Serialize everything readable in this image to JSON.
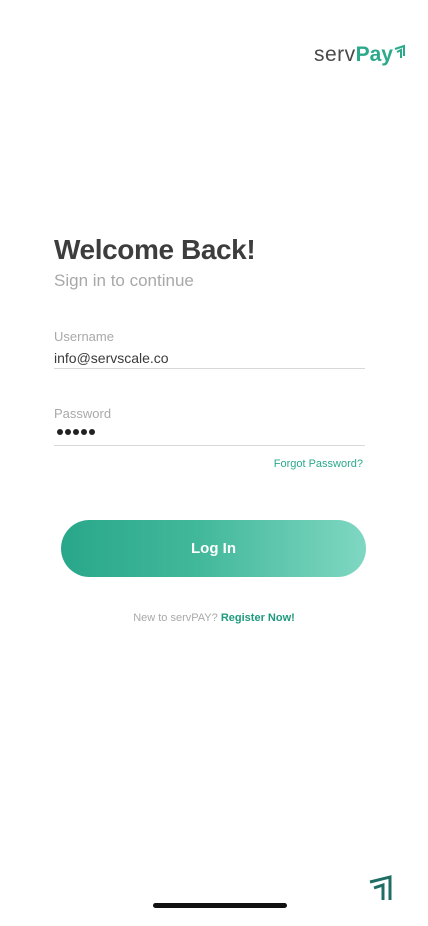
{
  "brand": {
    "logo_part1": "serv",
    "logo_part2": "Pay",
    "accent_color": "#2aa98b"
  },
  "header": {
    "title": "Welcome Back!",
    "subtitle": "Sign in to continue"
  },
  "form": {
    "username_label": "Username",
    "username_value": "info@servscale.co",
    "password_label": "Password",
    "password_length": 5,
    "forgot_label": "Forgot Password?",
    "login_label": "Log In"
  },
  "footer": {
    "prompt": "New to servPAY?",
    "register_label": "Register Now!"
  },
  "icons": {
    "logo_mark": "arrow-up-right-icon",
    "corner": "servpay-mark-icon"
  }
}
